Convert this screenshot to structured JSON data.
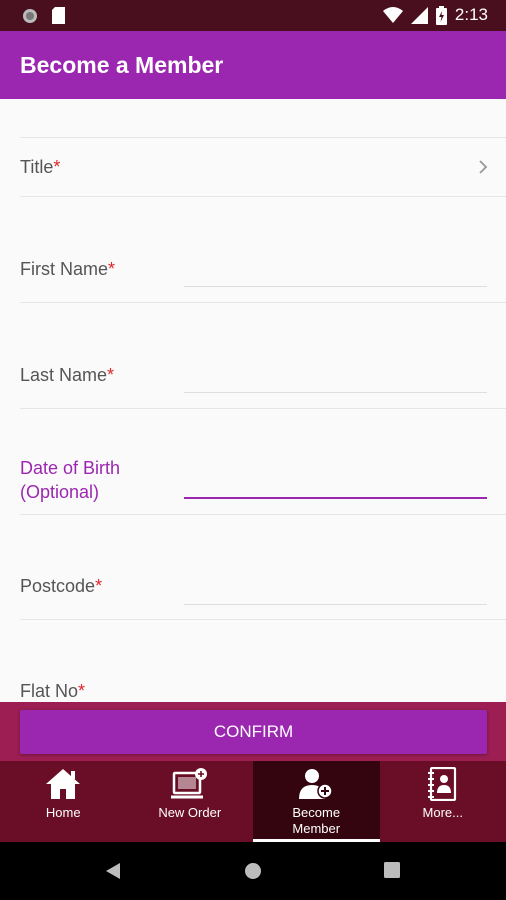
{
  "status_bar": {
    "time": "2:13"
  },
  "app_bar": {
    "title": "Become a Member"
  },
  "form": {
    "title_label": "Title",
    "first_name_label": "First Name",
    "last_name_label": "Last Name",
    "dob_label_line1": "Date of Birth",
    "dob_label_line2": "(Optional)",
    "postcode_label": "Postcode",
    "flat_label": "Flat No",
    "required_mark": "*"
  },
  "confirm": {
    "label": "CONFIRM"
  },
  "bottom_nav": {
    "items": [
      {
        "label": "Home",
        "icon": "home-icon"
      },
      {
        "label": "New Order",
        "icon": "new-order-icon"
      },
      {
        "label_line1": "Become",
        "label_line2": "Member",
        "icon": "add-member-icon",
        "selected": true
      },
      {
        "label": "More...",
        "icon": "more-icon"
      }
    ]
  },
  "colors": {
    "accent": "#9b27b0",
    "status_bar": "#4a0f1e",
    "bottom_nav": "#6a0d26",
    "bottom_nav_selected": "#35050f",
    "confirm_area": "#9c1e53",
    "required": "#e0262a"
  }
}
